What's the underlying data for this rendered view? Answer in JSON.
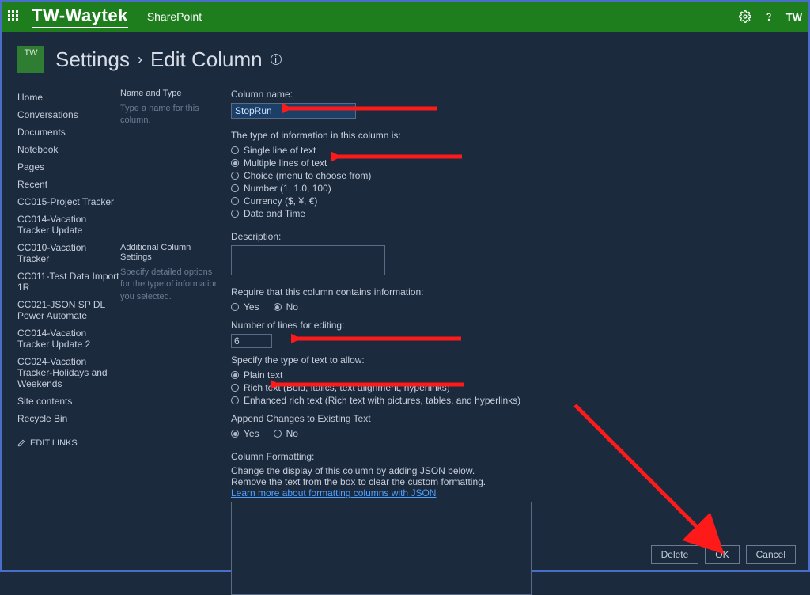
{
  "topbar": {
    "brand": "TW-Waytek",
    "app": "SharePoint",
    "userInitials": "TW"
  },
  "header": {
    "siteAbbrev": "TW",
    "settings": "Settings",
    "editColumn": "Edit Column"
  },
  "nav": {
    "items": [
      "Home",
      "Conversations",
      "Documents",
      "Notebook",
      "Pages",
      "Recent",
      "CC015-Project Tracker",
      "CC014-Vacation Tracker Update",
      "CC010-Vacation Tracker",
      "CC011-Test Data Import 1R",
      "CC021-JSON SP DL Power Automate",
      "CC014-Vacation Tracker Update 2",
      "CC024-Vacation Tracker-Holidays and Weekends",
      "Site contents",
      "Recycle Bin"
    ],
    "editLinks": "EDIT LINKS"
  },
  "mid": {
    "sec1Title": "Name and Type",
    "sec1Desc": "Type a name for this column.",
    "sec2Title": "Additional Column Settings",
    "sec2Desc": "Specify detailed options for the type of information you selected."
  },
  "form": {
    "colNameLabel": "Column name:",
    "colNameValue": "StopRun",
    "typeInfoLabel": "The type of information in this column is:",
    "types": {
      "single": "Single line of text",
      "multi": "Multiple lines of text",
      "choice": "Choice (menu to choose from)",
      "number": "Number (1, 1.0, 100)",
      "currency": "Currency ($, ¥, €)",
      "datetime": "Date and Time"
    },
    "descriptionLabel": "Description:",
    "requireLabel": "Require that this column contains information:",
    "yes": "Yes",
    "no": "No",
    "numLinesLabel": "Number of lines for editing:",
    "numLinesValue": "6",
    "textTypeLabel": "Specify the type of text to allow:",
    "plain": "Plain text",
    "rich": "Rich text (Bold, italics, text alignment, hyperlinks)",
    "enhanced": "Enhanced rich text (Rich text with pictures, tables, and hyperlinks)",
    "appendLabel": "Append Changes to Existing Text",
    "formattingTitle": "Column Formatting:",
    "formattingDesc1": "Change the display of this column by adding JSON below.",
    "formattingDesc2": "Remove the text from the box to clear the custom formatting.",
    "formattingLink": "Learn more about formatting columns with JSON"
  },
  "buttons": {
    "delete": "Delete",
    "ok": "OK",
    "cancel": "Cancel"
  }
}
